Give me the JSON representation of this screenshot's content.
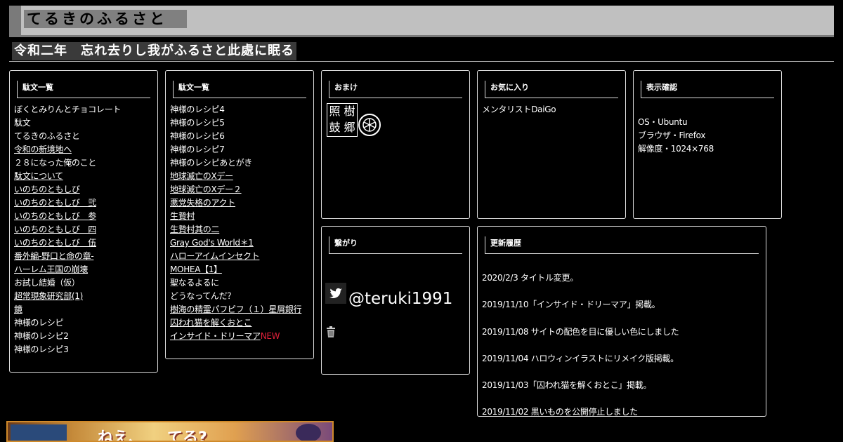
{
  "site": {
    "title": "てるきのふるさと",
    "subtitle": "令和二年　忘れ去りし我がふるさと此處に眠る"
  },
  "column1": {
    "heading": "駄文一覧",
    "items": [
      {
        "label": "ぼくとみりんとチョコレート",
        "link": false
      },
      {
        "label": "駄文",
        "link": false
      },
      {
        "label": "てるきのふるさと",
        "link": false
      },
      {
        "label": "令和の新境地へ",
        "link": true
      },
      {
        "label": "２８になった俺のこと",
        "link": false
      },
      {
        "label": "駄文について",
        "link": true
      },
      {
        "label": "いのちのともしび",
        "link": true
      },
      {
        "label": "いのちのともしび　弐",
        "link": true
      },
      {
        "label": "いのちのともしび　参",
        "link": true
      },
      {
        "label": "いのちのともしび　四",
        "link": true
      },
      {
        "label": "いのちのともしび　伍",
        "link": true
      },
      {
        "label": "番外編-野口と命の章-",
        "link": true
      },
      {
        "label": "ハーレム王国の崩壊",
        "link": true
      },
      {
        "label": "お試し結婚（仮）",
        "link": false
      },
      {
        "label": "超常現象研究部(1)",
        "link": true
      },
      {
        "label": "鏡",
        "link": true
      },
      {
        "label": "神様のレシピ",
        "link": false
      },
      {
        "label": "神様のレシピ2",
        "link": false
      },
      {
        "label": "神様のレシピ3",
        "link": false
      }
    ]
  },
  "column2": {
    "heading": "駄文一覧",
    "items": [
      {
        "label": "神様のレシピ4",
        "link": false
      },
      {
        "label": "神様のレシピ5",
        "link": false
      },
      {
        "label": "神様のレシピ6",
        "link": false
      },
      {
        "label": "神様のレシピ7",
        "link": false
      },
      {
        "label": "神様のレシピあとがき",
        "link": false
      },
      {
        "label": "地球滅亡のXデー",
        "link": true
      },
      {
        "label": "地球滅亡のXデー２",
        "link": true
      },
      {
        "label": "悪党失格のアクト",
        "link": true
      },
      {
        "label": "生贄村",
        "link": true
      },
      {
        "label": "生贄村其の二",
        "link": true
      },
      {
        "label": "Gray God's World＊1",
        "link": true
      },
      {
        "label": "ハローアイムインセクト",
        "link": true
      },
      {
        "label": "MOHEA【1】",
        "link": true
      },
      {
        "label": "聖なるよるに",
        "link": false
      },
      {
        "label": "どうなってんだ？",
        "link": false
      },
      {
        "label": "樹海の精霊パフピフ（１）星屑銀行",
        "link": true
      },
      {
        "label": "囚われ猫を解くおとこ",
        "link": true
      },
      {
        "label": "インサイド・ドリーマア",
        "link": true
      }
    ],
    "new_badge": "NEW"
  },
  "omake": {
    "heading": "おまけ",
    "seal_chars": [
      "照",
      "樹",
      "鼓",
      "郷"
    ],
    "seal_icon": "seal-stamp-icon",
    "crest_icon": "family-crest-icon"
  },
  "favorites": {
    "heading": "お気に入り",
    "items": [
      "メンタリストDaiGo"
    ]
  },
  "display": {
    "heading": "表示確認",
    "lines": [
      "OS・Ubuntu",
      "ブラウザ・Firefox",
      "解像度・1024×768"
    ]
  },
  "connect": {
    "heading": "繋がり",
    "twitter_handle": "@teruki1991",
    "twitter_icon": "twitter-bird-icon",
    "trash_icon": "trash-icon"
  },
  "history": {
    "heading": "更新履歴",
    "entries": [
      "2020/2/3 タイトル変更。",
      "2019/11/10「インサイド・ドリーマア」掲載。",
      "2019/11/08 サイトの配色を目に優しい色にしました",
      "2019/11/04 ハロウィンイラストにリメイク版掲載。",
      "2019/11/03「囚われ猫を解くおとこ」掲載。",
      "2019/11/02 黒いものを公開停止しました"
    ]
  },
  "banner": {
    "text": "ねえ、　　てる?"
  },
  "colors": {
    "background": "#000000",
    "header_gray": "#c0c0c0",
    "new_red": "#e0203a"
  }
}
